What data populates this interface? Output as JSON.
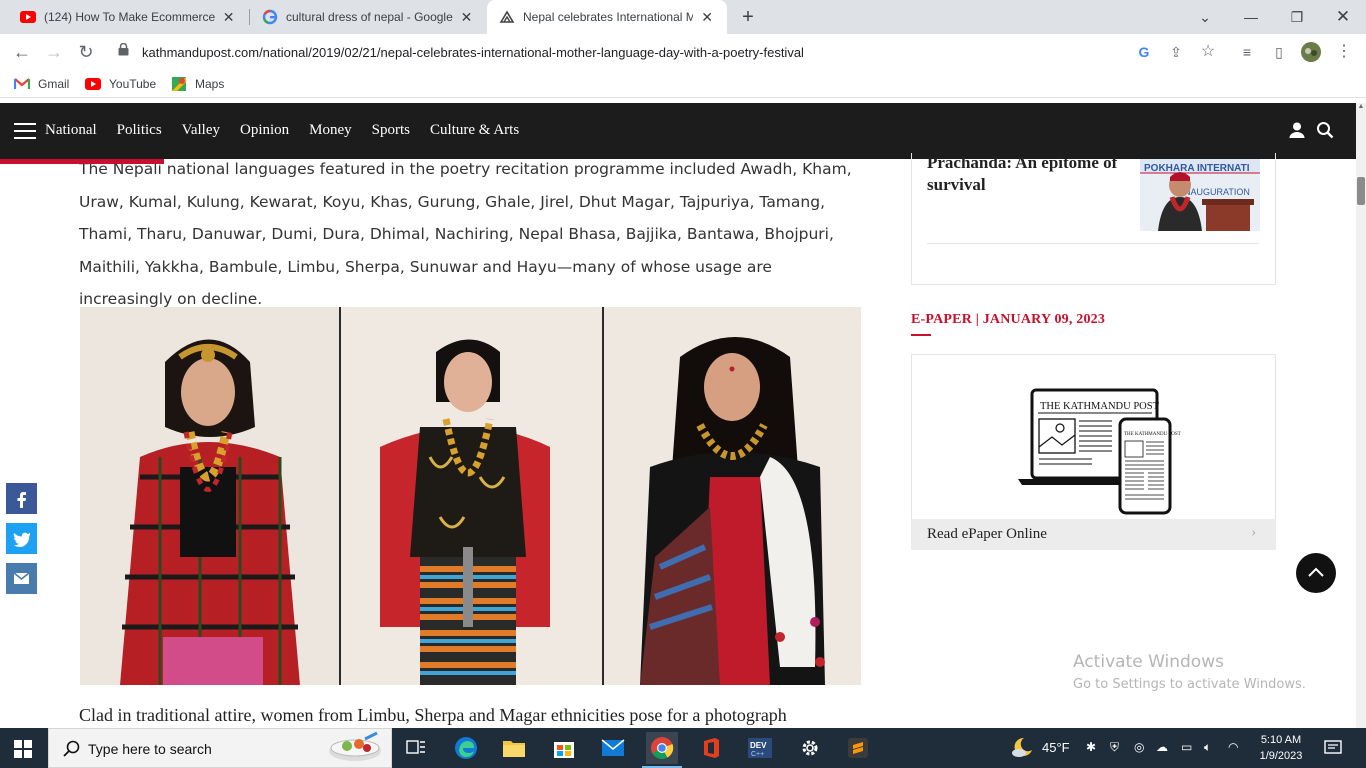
{
  "browser": {
    "tabs": [
      {
        "label": "(124) How To Make Ecommerce W",
        "icon": "youtube-icon",
        "active": false
      },
      {
        "label": "cultural dress of nepal - Google S",
        "icon": "google-icon",
        "active": false
      },
      {
        "label": "Nepal celebrates International M",
        "icon": "kathmandu-post-icon",
        "active": true
      }
    ],
    "url": "kathmandupost.com/national/2019/02/21/nepal-celebrates-international-mother-language-day-with-a-poetry-festival",
    "bookmarks": [
      {
        "label": "Gmail",
        "icon": "gmail-icon"
      },
      {
        "label": "YouTube",
        "icon": "youtube-icon"
      },
      {
        "label": "Maps",
        "icon": "maps-icon"
      }
    ]
  },
  "site_nav": {
    "links": [
      "National",
      "Politics",
      "Valley",
      "Opinion",
      "Money",
      "Sports",
      "Culture & Arts"
    ]
  },
  "article": {
    "paragraph": "The Nepali national languages featured in the poetry recitation programme included Awadh, Kham, Uraw, Kumal, Kulung, Kewarat, Koyu, Khas, Gurung, Ghale, Jirel, Dhut Magar, Tajpuriya, Tamang, Thami, Tharu, Danuwar, Dumi, Dura, Dhimal, Nachiring, Nepal Bhasa, Bajjika, Bantawa, Bhojpuri, Maithili, Yakkha, Bambule, Limbu, Sherpa, Sunuwar and Hayu—many of whose usage are increasingly on decline.",
    "caption": "Clad in traditional attire, women from Limbu, Sherpa and Magar ethnicities pose for a photograph"
  },
  "sidebar": {
    "story_title": "Prachanda: An epitome of survival",
    "thumb_text": "POKHARA INTERNATI",
    "thumb_text2": "NAUGURATION",
    "epaper_heading": "E-PAPER | JANUARY 09, 2023",
    "epaper_masthead": "THE KATHMANDU POST",
    "epaper_link": "Read ePaper Online"
  },
  "watermark": {
    "line1": "Activate Windows",
    "line2": "Go to Settings to activate Windows."
  },
  "taskbar": {
    "search_placeholder": "Type here to search",
    "weather": "45°F",
    "time": "5:10 AM",
    "date": "1/9/2023"
  }
}
